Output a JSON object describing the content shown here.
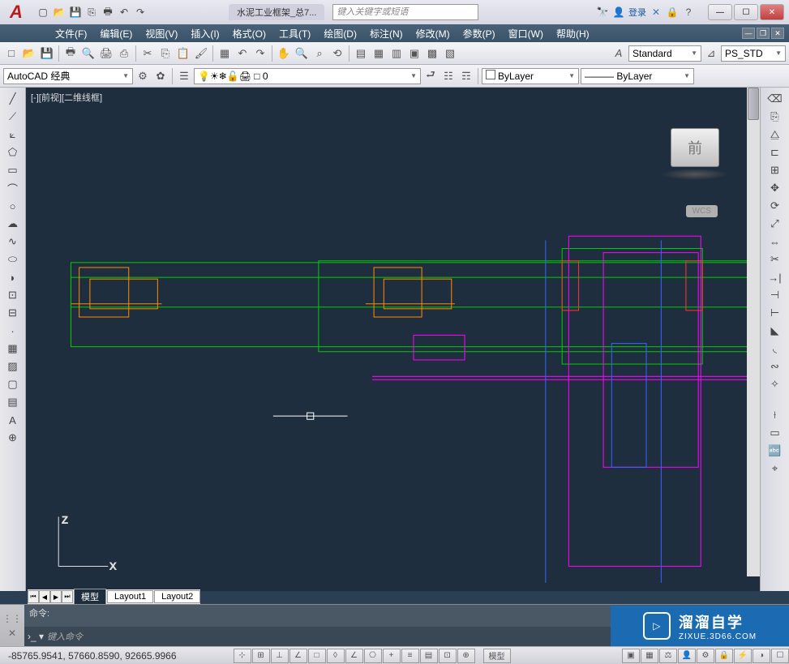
{
  "titlebar": {
    "doc_tab": "水泥工业框架_总7...",
    "search_placeholder": "键入关键字或短语",
    "login": "登录"
  },
  "menubar": {
    "items": [
      "文件(F)",
      "编辑(E)",
      "视图(V)",
      "插入(I)",
      "格式(O)",
      "工具(T)",
      "绘图(D)",
      "标注(N)",
      "修改(M)",
      "参数(P)",
      "窗口(W)",
      "帮助(H)"
    ]
  },
  "toolbar": {
    "text_style": "Standard",
    "dim_style": "PS_STD"
  },
  "workspace": {
    "label": "AutoCAD 经典",
    "layer": "0",
    "prop_color": "ByLayer",
    "linetype": "ByLayer"
  },
  "canvas": {
    "header": "[-][前视][二维线框]",
    "view_cube": "前",
    "wcs": "WCS",
    "axis_z": "Z",
    "axis_x": "X"
  },
  "layout_tabs": {
    "tabs": [
      "模型",
      "Layout1",
      "Layout2"
    ]
  },
  "command": {
    "history": "命令:",
    "prompt_icon": "›_",
    "input_placeholder": "键入命令"
  },
  "statusbar": {
    "coords": "-85765.9541, 57660.8590, 92665.9966",
    "model_label": "模型"
  },
  "watermark": {
    "cn": "溜溜自学",
    "url": "ZIXUE.3D66.COM"
  }
}
